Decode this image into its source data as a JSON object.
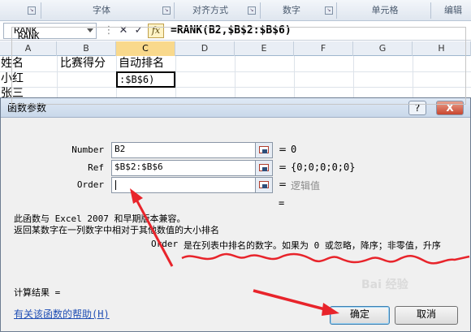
{
  "ribbon": {
    "groups": [
      "字体",
      "对齐方式",
      "数字",
      "单元格",
      "编辑"
    ]
  },
  "formula_bar": {
    "name_box": "RANK",
    "cancel_glyph": "✕",
    "enter_glyph": "✓",
    "fx_label": "fx",
    "formula": "=RANK(B2,$B$2:$B$6)"
  },
  "sheet": {
    "columns": [
      "A",
      "B",
      "C",
      "D",
      "E",
      "F",
      "G",
      "H"
    ],
    "selected_column": "C",
    "rows": [
      [
        "姓名",
        "比赛得分",
        "自动排名"
      ],
      [
        "小红",
        "",
        ":$B$6)"
      ],
      [
        "张三",
        "",
        ""
      ]
    ]
  },
  "dialog": {
    "title": "函数参数",
    "help_btn": "?",
    "close_btn": "X",
    "function_name": "RANK",
    "args": [
      {
        "label": "Number",
        "value": "B2",
        "result": "0"
      },
      {
        "label": "Ref",
        "value": "$B$2:$B$6",
        "result": "{0;0;0;0;0}"
      },
      {
        "label": "Order",
        "value": "",
        "result": "逻辑值"
      }
    ],
    "formula_result_eq": "=",
    "description_line1": "此函数与 Excel 2007 和早期版本兼容。",
    "description_line2": "返回某数字在一列数字中相对于其他数值的大小排名",
    "order_help_label": "Order",
    "order_help_text": "是在列表中排名的数字。如果为 0 或忽略，降序；非零值，升序",
    "calc_result_label": "计算结果 =",
    "help_link": "有关该函数的帮助(H)",
    "ok_label": "确定",
    "cancel_label": "取消"
  },
  "colors": {
    "annotation_red": "#e8242b",
    "link_blue": "#1f4eb4",
    "selected_header": "#f9d98c"
  },
  "icons": [
    "cancel-icon",
    "enter-icon",
    "fx-icon",
    "collapse-dialog-icon"
  ]
}
